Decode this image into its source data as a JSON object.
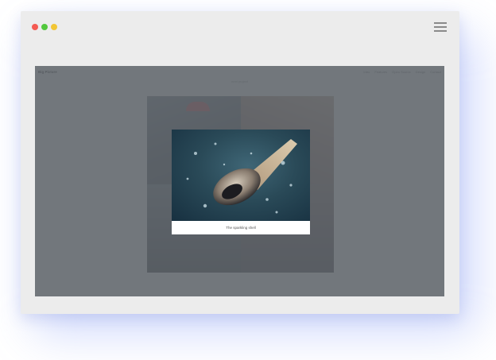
{
  "window": {
    "controls": [
      {
        "name": "close-dot",
        "color": "#f45a52"
      },
      {
        "name": "minimize-dot",
        "color": "#52c83d"
      },
      {
        "name": "maximize-dot",
        "color": "#f2c635"
      }
    ],
    "menu_icon": "hamburger-menu-icon"
  },
  "site": {
    "brand": "Big Picture",
    "nav": [
      "Intro",
      "Features",
      "Open Source",
      "Design",
      "Contact"
    ],
    "subtitle": "next project"
  },
  "gallery": {
    "tiles": [
      "umbrella-photo",
      "building-photo",
      "escalator-photo",
      "heart-photo"
    ]
  },
  "lightbox": {
    "caption": "The sparkling shell",
    "image": "sparkling-shell-photo"
  },
  "colors": {
    "overlay": "#5f646a",
    "browser_chrome": "#ececec",
    "shadow_glow": "#6e87f5"
  }
}
